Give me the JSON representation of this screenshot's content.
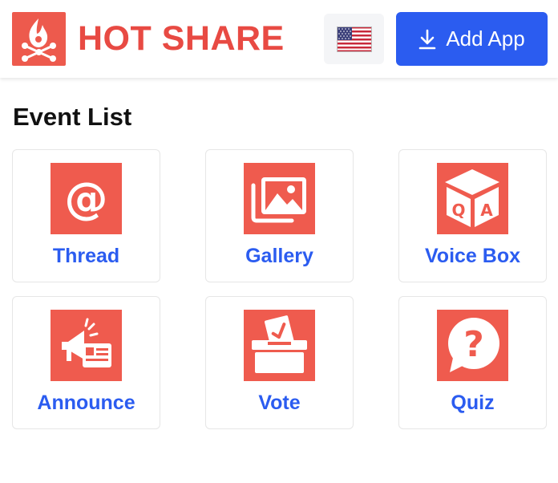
{
  "header": {
    "brand": "HOT SHARE",
    "logo_icon": "campfire-network-icon",
    "language_flag": "us-flag-icon",
    "add_app_label": "Add App",
    "add_app_icon": "download-icon",
    "brand_color": "#e84a43",
    "accent_color": "#2b5cf0"
  },
  "main": {
    "section_title": "Event List",
    "events": [
      {
        "label": "Thread",
        "icon": "at-sign-icon"
      },
      {
        "label": "Gallery",
        "icon": "gallery-icon"
      },
      {
        "label": "Voice Box",
        "icon": "qa-cube-icon"
      },
      {
        "label": "Announce",
        "icon": "megaphone-icon"
      },
      {
        "label": "Vote",
        "icon": "ballot-box-icon"
      },
      {
        "label": "Quiz",
        "icon": "question-bubble-icon"
      }
    ],
    "icon_bg_color": "#ef5b4e"
  }
}
